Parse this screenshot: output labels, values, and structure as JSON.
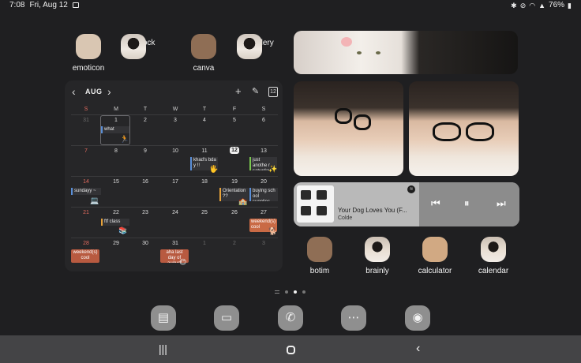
{
  "status_bar": {
    "time": "7:08",
    "date": "Fri, Aug 12",
    "battery": "76%"
  },
  "top_apps": [
    {
      "label": "emoticon"
    },
    {
      "label": "clock"
    },
    {
      "label": "canva"
    },
    {
      "label": "gallery"
    }
  ],
  "calendar": {
    "month": "AUG",
    "today_icon": "12",
    "weekdays": [
      "S",
      "M",
      "T",
      "W",
      "T",
      "F",
      "S"
    ],
    "weeks": [
      [
        "31",
        "1",
        "2",
        "3",
        "4",
        "5",
        "6"
      ],
      [
        "7",
        "8",
        "9",
        "10",
        "11",
        "12",
        "13"
      ],
      [
        "14",
        "15",
        "16",
        "17",
        "18",
        "19",
        "20"
      ],
      [
        "21",
        "22",
        "23",
        "24",
        "25",
        "26",
        "27"
      ],
      [
        "28",
        "29",
        "30",
        "31",
        "1",
        "2",
        "3"
      ]
    ],
    "events": {
      "what": "what",
      "khads_bday": "khad's bda y !!",
      "just_another_saturday": "just anothe r saturday",
      "sundayy": "sundayy ~",
      "orientation": "Orientation ??",
      "buying_school": "buying sch ool supplies",
      "ftf_class": "ftf class",
      "weekends_cool_1": "weekend(s) cool",
      "weekends_cool_2": "weekend(s) cool",
      "last_day_of_august": "aha last day of august"
    }
  },
  "music": {
    "title": "Your Dog Loves You (F...",
    "artist": "Colde"
  },
  "bottom_apps": [
    {
      "label": "botim"
    },
    {
      "label": "brainly"
    },
    {
      "label": "calculator"
    },
    {
      "label": "calendar"
    }
  ],
  "dock": [
    "notes-icon",
    "messages-icon",
    "phone-icon",
    "chat-icon",
    "camera-icon"
  ],
  "colors": {
    "background": "#1f1f21",
    "sunday_red": "#e06a5e",
    "event_pill": "#b85a40"
  }
}
